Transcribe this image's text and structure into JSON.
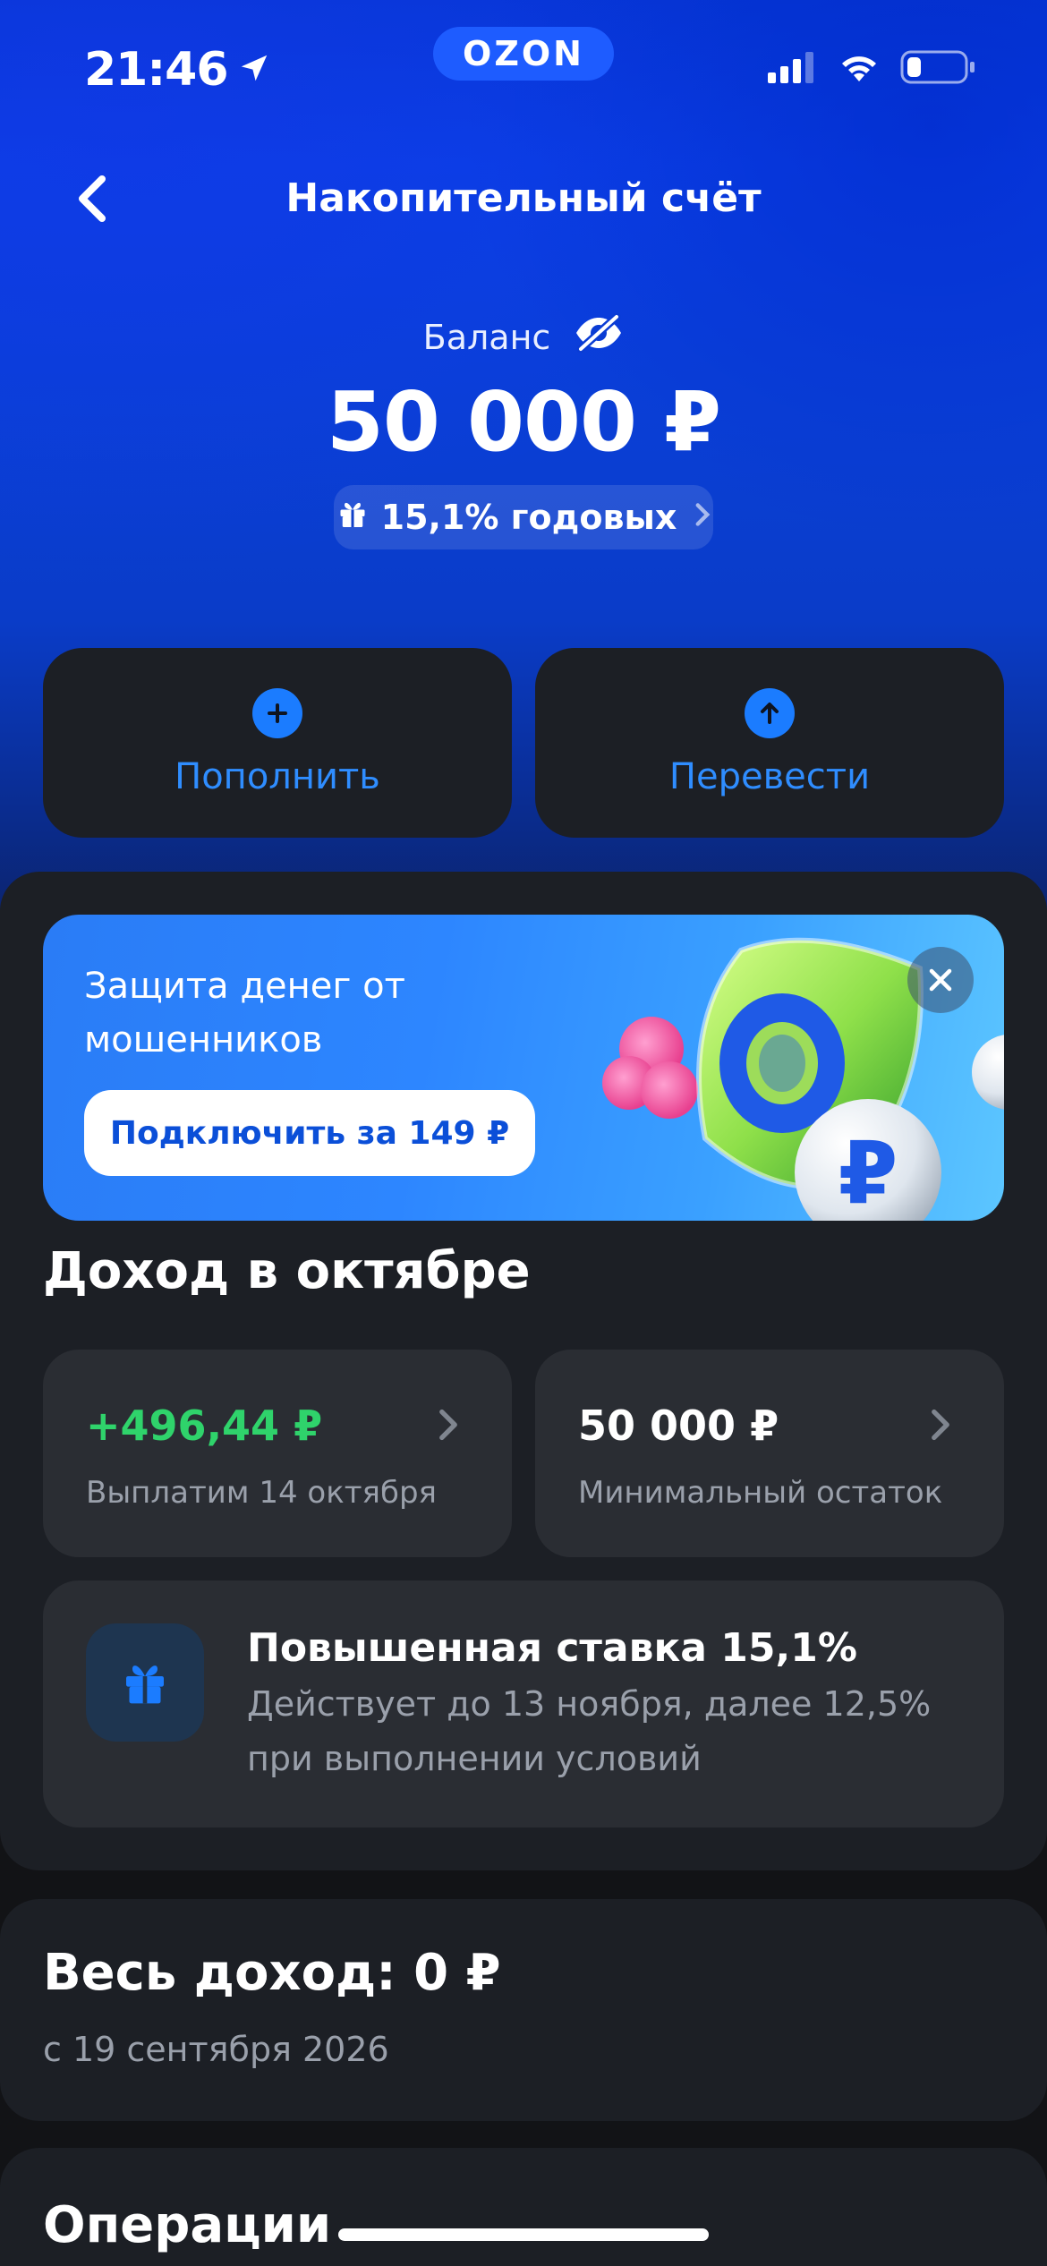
{
  "status_bar": {
    "time": "21:46",
    "brand": "OZON",
    "battery_level": 0.25
  },
  "nav": {
    "title": "Накопительный счёт"
  },
  "balance": {
    "label": "Баланс",
    "amount": "50 000 ₽",
    "rate_chip": "15,1% годовых"
  },
  "actions": {
    "topup_label": "Пополнить",
    "transfer_label": "Перевести"
  },
  "promo": {
    "title": "Защита денег от мошенников",
    "button_label": "Подключить за 149 ₽"
  },
  "income_month": {
    "title": "Доход в октябре",
    "payout_value": "+496,44 ₽",
    "payout_label": "Выплатим 14 октября",
    "min_balance_value": "50 000 ₽",
    "min_balance_label": "Минимальный остаток"
  },
  "rate_info": {
    "title": "Повышенная ставка 15,1%",
    "description": "Действует до 13 ноября, далее 12,5% при выполнении условий"
  },
  "total_income": {
    "title": "Весь доход: 0 ₽",
    "since": "с 19 сентября 2026"
  },
  "operations": {
    "title": "Операции"
  },
  "colors": {
    "accent": "#1b7cff",
    "positive": "#2fd36b",
    "card": "#1c1f25",
    "hero_blue": "#0a3fe6"
  }
}
